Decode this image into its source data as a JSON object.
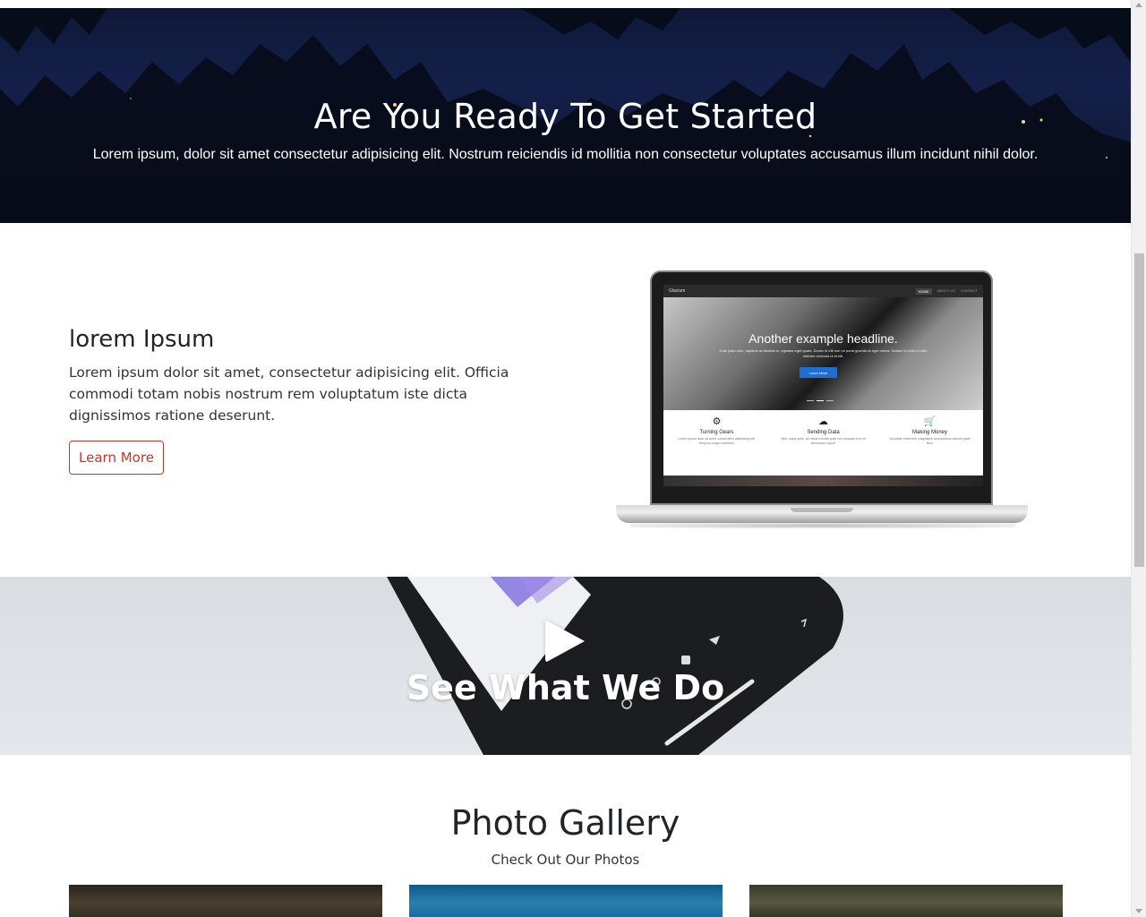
{
  "hero": {
    "title": "Are You Ready To Get Started",
    "text": "Lorem ipsum, dolor sit amet consectetur adipisicing elit. Nostrum reiciendis id mollitia non consectetur voluptates accusamus illum incidunt nihil dolor."
  },
  "feature": {
    "title": "lorem Ipsum",
    "text": "Lorem ipsum dolor sit amet, consectetur adipisicing elit. Officia commodi totam nobis nostrum rem voluptatum iste dicta dignissimos ratione deserunt.",
    "button": "Learn More",
    "accent_color": "#c0392b"
  },
  "laptop_screen": {
    "brand": "Glacium",
    "nav": [
      "HOME",
      "ABOUT US",
      "CONTACT"
    ],
    "headline": "Another example headline.",
    "subtext": "Cras justo odio, dapibus ac facilisis in, egestas eget quam. Donec id elit non mi porta gravida at eget metus. Nullam id dolor id nibh ultricies vehicula ut id elit.",
    "button": "Learn More",
    "columns": [
      {
        "icon": "gear-icon",
        "glyph": "⚙",
        "title": "Turning Gears",
        "text": "Lorem ipsum dolor sit amet, consectetur adipisicing elit, tempora magni doloribus"
      },
      {
        "icon": "cloud-icon",
        "glyph": "☁",
        "title": "Sending Data",
        "text": "Nihil, culpa optio, ad natus eveniet quae nisi voluptas error et laboriosam ipsum"
      },
      {
        "icon": "cart-icon",
        "glyph": "🛒",
        "title": "Making Money",
        "text": "Voluptate ensemble voluptatem accusantium dolores quae illum"
      }
    ]
  },
  "video": {
    "title": "See What We Do",
    "play_icon": "play-icon"
  },
  "gallery": {
    "title": "Photo Gallery",
    "subtitle": "Check Out Our Photos"
  }
}
